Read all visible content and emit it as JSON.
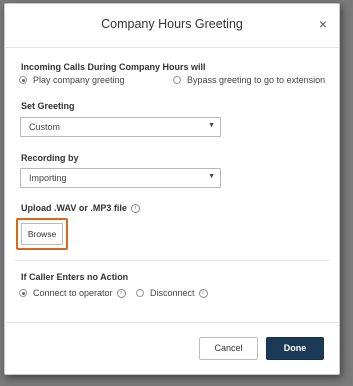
{
  "dialog": {
    "title": "Company Hours Greeting",
    "close_label": "×"
  },
  "incoming": {
    "label": "Incoming Calls During Company Hours will",
    "option_play": "Play company greeting",
    "option_bypass": "Bypass greeting to go to extension",
    "selected": "Play company greeting"
  },
  "greeting": {
    "label": "Set Greeting",
    "value": "Custom"
  },
  "recording": {
    "label": "Recording by",
    "value": "Importing"
  },
  "upload": {
    "label": "Upload .WAV or .MP3 file",
    "browse_label": "Browse"
  },
  "no_action": {
    "label": "If Caller Enters no Action",
    "option_connect": "Connect to operator",
    "option_disconnect": "Disconnect",
    "selected": "Connect to operator"
  },
  "footer": {
    "cancel_label": "Cancel",
    "done_label": "Done"
  },
  "icons": {
    "info": "info-icon",
    "caret": "chevron-down-icon",
    "close": "close-icon"
  },
  "colors": {
    "highlight": "#d8691a",
    "primary": "#1c3a56"
  }
}
